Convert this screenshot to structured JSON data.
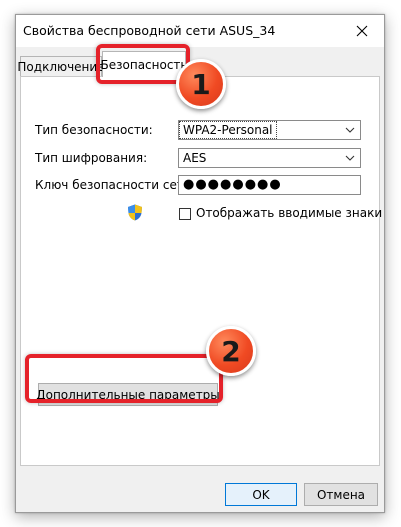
{
  "window": {
    "title": "Свойства беспроводной сети ASUS_34",
    "close_glyph": "✕"
  },
  "tabs": [
    {
      "label": "Подключение",
      "active": false
    },
    {
      "label": "Безопасность",
      "active": true
    }
  ],
  "security": {
    "type_label": "Тип безопасности:",
    "type_value": "WPA2-Personal",
    "encryption_label": "Тип шифрования:",
    "encryption_value": "AES",
    "key_label": "Ключ безопасности сети",
    "key_value": "●●●●●●●●",
    "show_chars_label": "Отображать вводимые знаки",
    "show_chars_checked": false,
    "shield_icon": "uac-shield-icon"
  },
  "advanced_button": "Дополнительные параметры",
  "footer": {
    "ok": "OK",
    "cancel": "Отмена"
  },
  "annotations": {
    "badge_1": "1",
    "badge_2": "2",
    "highlight_color": "#e5222a",
    "badge_color": "#f04a23"
  }
}
